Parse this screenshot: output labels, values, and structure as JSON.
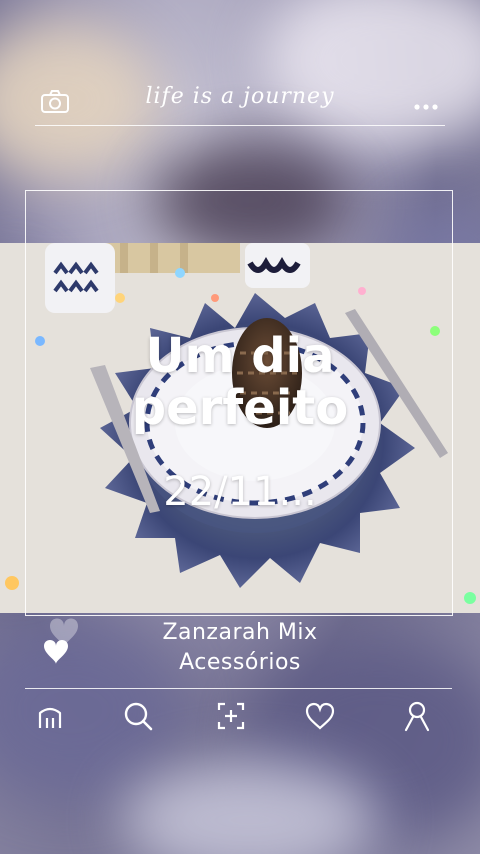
{
  "header": {
    "brand": "life is a journey",
    "camera_icon": "camera-icon",
    "more_icon": "more-dots-icon"
  },
  "post": {
    "headline_line1": "Um dia",
    "headline_line2": "perfeito",
    "date": "22/11...",
    "caption_line1": "Zanzarah Mix",
    "caption_line2": "Acessórios"
  },
  "nav": {
    "items": [
      {
        "icon": "home-icon"
      },
      {
        "icon": "search-icon"
      },
      {
        "icon": "add-icon"
      },
      {
        "icon": "heart-icon"
      },
      {
        "icon": "profile-icon"
      }
    ]
  },
  "colors": {
    "overlay_white": "#ffffff",
    "doily_blue": "#3d4a7a",
    "background": "#9b97b3"
  }
}
